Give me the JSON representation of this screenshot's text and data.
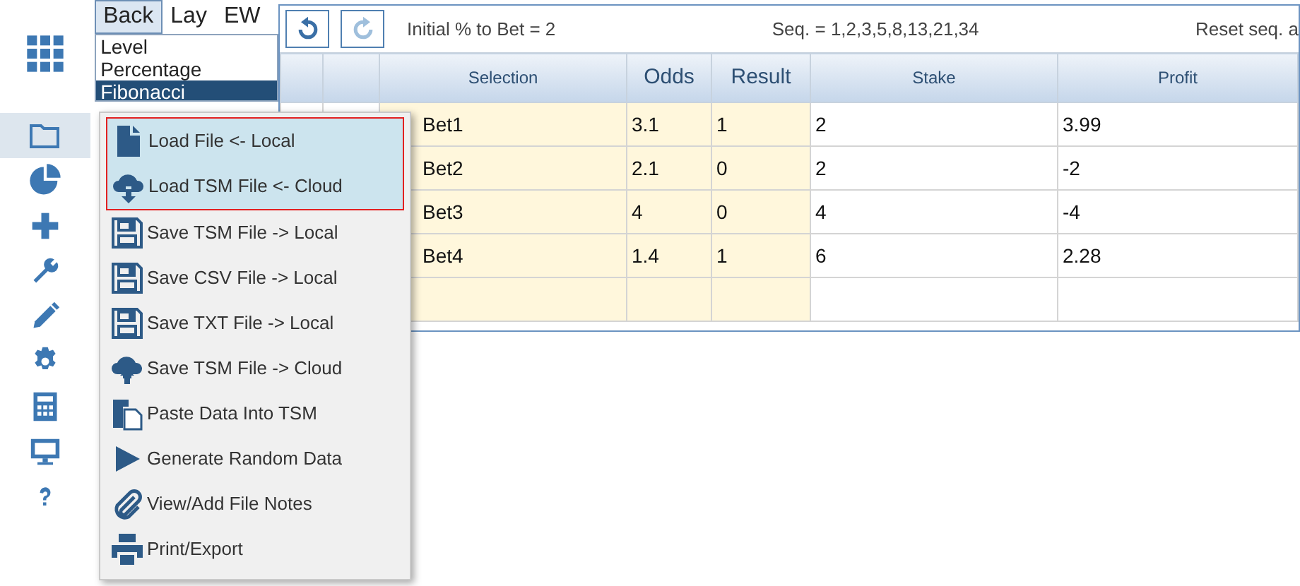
{
  "sidebar": {
    "items": [
      {
        "selected": false
      },
      {
        "selected": true
      },
      {
        "selected": false
      },
      {
        "selected": false
      },
      {
        "selected": false
      },
      {
        "selected": false
      },
      {
        "selected": false
      },
      {
        "selected": false
      },
      {
        "selected": false
      },
      {
        "selected": false
      }
    ]
  },
  "bet_tabs": [
    {
      "label": "Back",
      "selected": true
    },
    {
      "label": "Lay",
      "selected": false
    },
    {
      "label": "EW",
      "selected": false
    }
  ],
  "strategy_list": [
    {
      "label": "Level",
      "selected": false
    },
    {
      "label": "Percentage",
      "selected": false
    },
    {
      "label": "Fibonacci",
      "selected": true
    }
  ],
  "toolbar": {
    "info": [
      "Initial % to Bet = 2",
      "Seq. = 1,2,3,5,8,13,21,34",
      "Reset seq. a"
    ]
  },
  "table": {
    "columns": [
      "",
      "",
      "Selection",
      "Odds",
      "Result",
      "Stake",
      "Profit"
    ],
    "rows": [
      [
        "",
        "",
        "Bet1",
        "3.1",
        "1",
        "2",
        "3.99"
      ],
      [
        "",
        "",
        "Bet2",
        "2.1",
        "0",
        "2",
        "-2"
      ],
      [
        "",
        "",
        "Bet3",
        "4",
        "0",
        "4",
        "-4"
      ],
      [
        "",
        "",
        "Bet4",
        "1.4",
        "1",
        "6",
        "2.28"
      ],
      [
        "",
        "",
        "",
        "",
        "",
        "",
        ""
      ]
    ]
  },
  "file_menu": [
    {
      "label": "Load File <- Local",
      "highlighted": true
    },
    {
      "label": "Load TSM File <- Cloud",
      "highlighted": true
    },
    {
      "label": "Save TSM File -> Local",
      "highlighted": false
    },
    {
      "label": "Save CSV File -> Local",
      "highlighted": false
    },
    {
      "label": "Save TXT File -> Local",
      "highlighted": false
    },
    {
      "label": "Save TSM File -> Cloud",
      "highlighted": false
    },
    {
      "label": "Paste Data Into TSM",
      "highlighted": false
    },
    {
      "label": "Generate Random Data",
      "highlighted": false
    },
    {
      "label": "View/Add File Notes",
      "highlighted": false
    },
    {
      "label": "Print/Export",
      "highlighted": false
    }
  ]
}
